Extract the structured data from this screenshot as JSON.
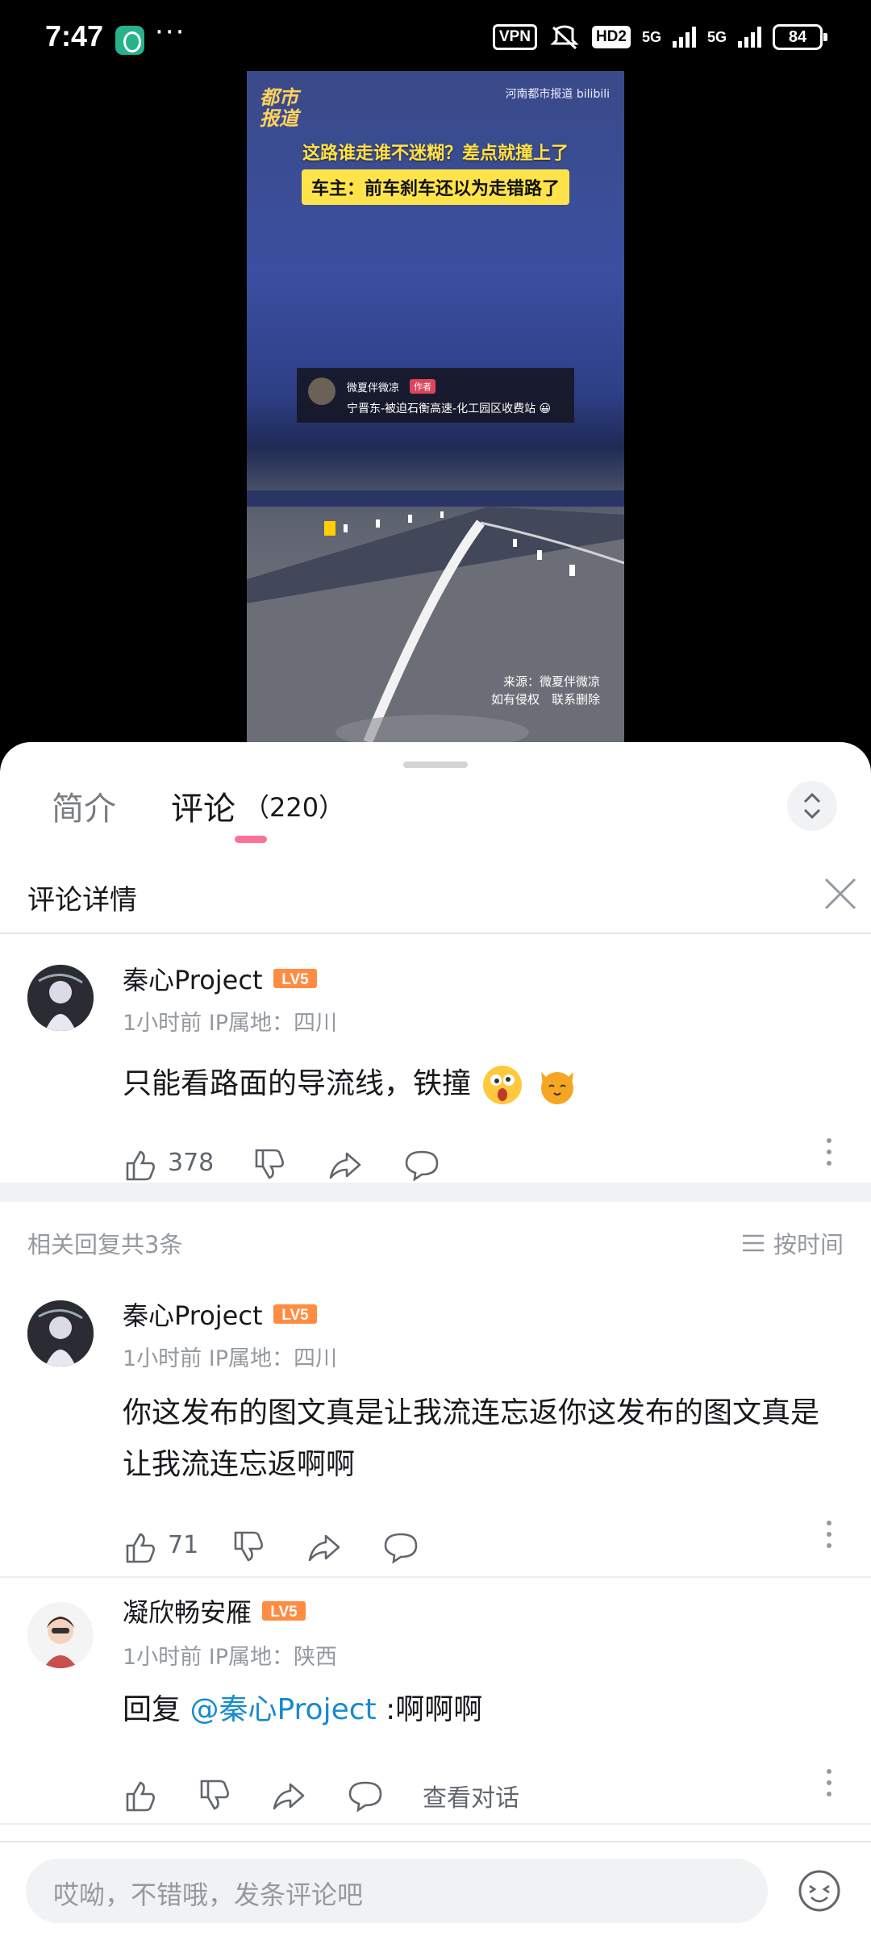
{
  "status_bar": {
    "time": "7:47",
    "dots": "···",
    "vpn": "VPN",
    "hd": "HD2",
    "net1": "5G",
    "net2": "5G",
    "battery": "84"
  },
  "video": {
    "logo_line1": "都市",
    "logo_line2": "报道",
    "top_right": "河南都市报道 bilibili",
    "headline": "这路谁走谁不迷糊？差点就撞上了",
    "subtitle": "车主：前车刹车还以为走错路了",
    "card_name": "微夏伴微凉",
    "card_badge": "作者",
    "card_text": "宁晋东-被迫石衡高速-化工园区收费站 😀",
    "source_line1": "来源：微夏伴微凉",
    "source_line2": "如有侵权　联系删除"
  },
  "tabs": {
    "intro": "简介",
    "comments": "评论",
    "comment_count": "（220）"
  },
  "detail": {
    "title": "评论详情"
  },
  "main_comment": {
    "user": "秦心Project",
    "level": "LV5",
    "meta": "1小时前 IP属地：四川",
    "text": "只能看路面的导流线，铁撞",
    "likes": "378"
  },
  "related": {
    "title": "相关回复共3条",
    "sort": "按时间"
  },
  "replies": [
    {
      "user": "秦心Project",
      "level": "LV5",
      "meta": "1小时前 IP属地：四川",
      "text": "你这发布的图文真是让我流连忘返你这发布的图文真是让我流连忘返啊啊",
      "likes": "71"
    },
    {
      "user": "凝欣畅安雁",
      "level": "LV5",
      "meta": "1小时前 IP属地：陕西",
      "prefix": "回复 ",
      "mention": "@秦心Project",
      "suffix": " :啊啊啊",
      "talk": "查看对话"
    }
  ],
  "input": {
    "placeholder": "哎呦，不错哦，发条评论吧"
  },
  "colors": {
    "accent": "#fb7299",
    "level_badge": "#ff8c42",
    "mention": "#178bcf"
  }
}
